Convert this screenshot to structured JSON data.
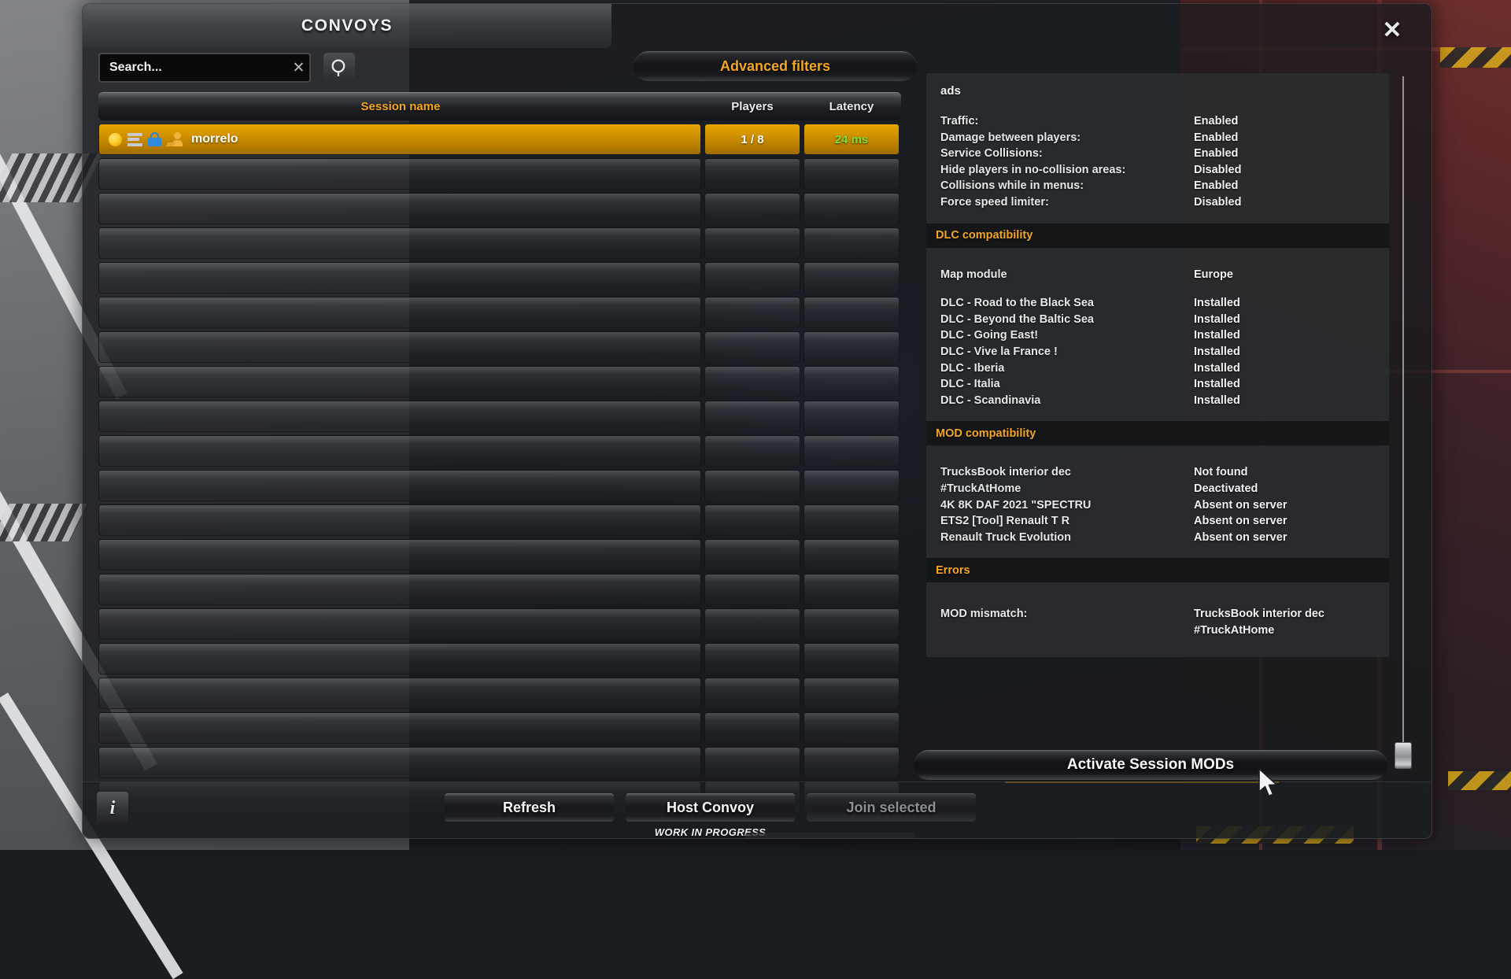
{
  "window": {
    "title": "CONVOYS",
    "close_icon": "close-icon"
  },
  "search": {
    "placeholder": "Search...",
    "value": "",
    "clear_icon": "close-icon",
    "search_icon": "search-icon"
  },
  "toolbar": {
    "advanced_filters_label": "Advanced filters"
  },
  "table": {
    "columns": {
      "session_name": "Session name",
      "players": "Players",
      "latency": "Latency"
    },
    "rows": [
      {
        "session_name": "morrelo",
        "players": "1 / 8",
        "latency": "24 ms",
        "selected": true,
        "icons": [
          "status-dot-icon",
          "server-list-icon",
          "lock-icon",
          "person-icon"
        ]
      }
    ],
    "empty_row_count": 19
  },
  "detail": {
    "server_name": "ads",
    "settings": [
      {
        "label": "Traffic:",
        "value": "Enabled"
      },
      {
        "label": "Damage between players:",
        "value": "Enabled"
      },
      {
        "label": "Service Collisions:",
        "value": "Enabled"
      },
      {
        "label": "Hide players in no-collision areas:",
        "value": "Disabled"
      },
      {
        "label": "Collisions while in menus:",
        "value": "Enabled"
      },
      {
        "label": "Force speed limiter:",
        "value": "Disabled"
      }
    ],
    "dlc_section_title": "DLC compatibility",
    "map_module": {
      "label": "Map module",
      "value": "Europe"
    },
    "dlc_items": [
      {
        "label": "DLC - Road to the Black Sea",
        "value": "Installed"
      },
      {
        "label": "DLC - Beyond the Baltic Sea",
        "value": "Installed"
      },
      {
        "label": "DLC - Going East!",
        "value": "Installed"
      },
      {
        "label": "DLC - Vive la France !",
        "value": "Installed"
      },
      {
        "label": "DLC - Iberia",
        "value": "Installed"
      },
      {
        "label": "DLC - Italia",
        "value": "Installed"
      },
      {
        "label": "DLC - Scandinavia",
        "value": "Installed"
      }
    ],
    "mod_section_title": "MOD compatibility",
    "mod_items": [
      {
        "label": "TrucksBook interior dec",
        "value": "Not found"
      },
      {
        "label": "#TruckAtHome",
        "value": "Deactivated"
      },
      {
        "label": "4K 8K DAF 2021 \"SPECTRU",
        "value": "Absent on server"
      },
      {
        "label": "ETS2 [Tool] Renault T R",
        "value": "Absent on server"
      },
      {
        "label": "Renault Truck Evolution",
        "value": "Absent on server"
      }
    ],
    "errors_section_title": "Errors",
    "errors": [
      {
        "label": "MOD mismatch:",
        "value_line1": "TrucksBook interior dec",
        "value_line2": "#TruckAtHome"
      }
    ]
  },
  "actions": {
    "activate_session_mods": "Activate Session MODs",
    "refresh": "Refresh",
    "host_convoy": "Host Convoy",
    "join_selected": "Join selected",
    "work_in_progress": "WORK IN PROGRESS",
    "info_label": "i"
  },
  "colors": {
    "accent_orange": "#f5a623",
    "selected_row": "#d69600",
    "latency_green": "#7de03a",
    "error_red": "#ee2222",
    "panel_bg": "#2b2d30"
  }
}
